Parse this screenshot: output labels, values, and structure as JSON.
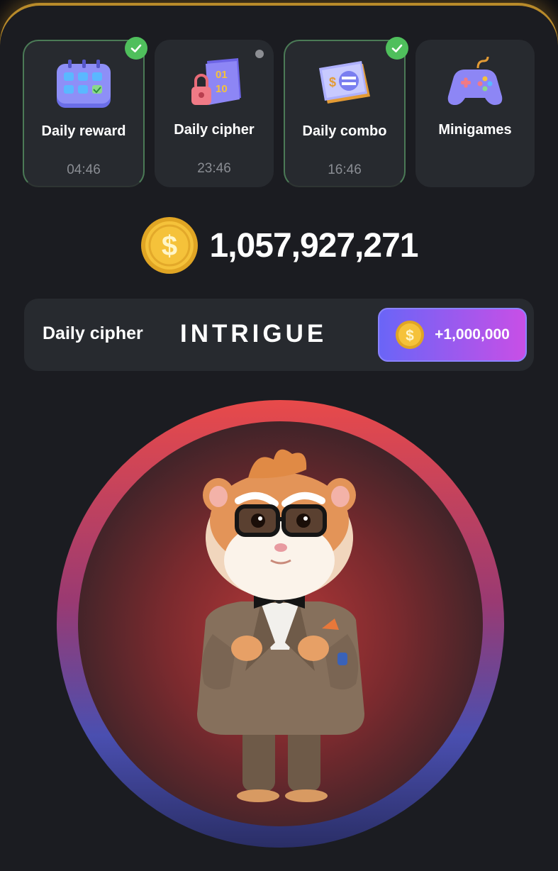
{
  "daily_cards": [
    {
      "label": "Daily reward",
      "timer": "04:46",
      "status": "completed",
      "icon": "calendar-icon"
    },
    {
      "label": "Daily cipher",
      "timer": "23:46",
      "status": "pending",
      "icon": "cipher-lock-icon"
    },
    {
      "label": "Daily combo",
      "timer": "16:46",
      "status": "completed",
      "icon": "coin-card-icon"
    },
    {
      "label": "Minigames",
      "timer": "",
      "status": "none",
      "icon": "gamepad-icon"
    }
  ],
  "balance": {
    "value": "1,057,927,271",
    "icon": "dollar-coin-icon"
  },
  "cipher": {
    "label": "Daily cipher",
    "word": "INTRIGUE",
    "reward": "+1,000,000",
    "reward_icon": "dollar-coin-icon"
  },
  "colors": {
    "accent_purple": "#6a65f7",
    "accent_pink": "#c84fe6",
    "check_green": "#4fbf5c",
    "coin_gold": "#f5c23a",
    "frame_gold": "#b88a2a"
  }
}
